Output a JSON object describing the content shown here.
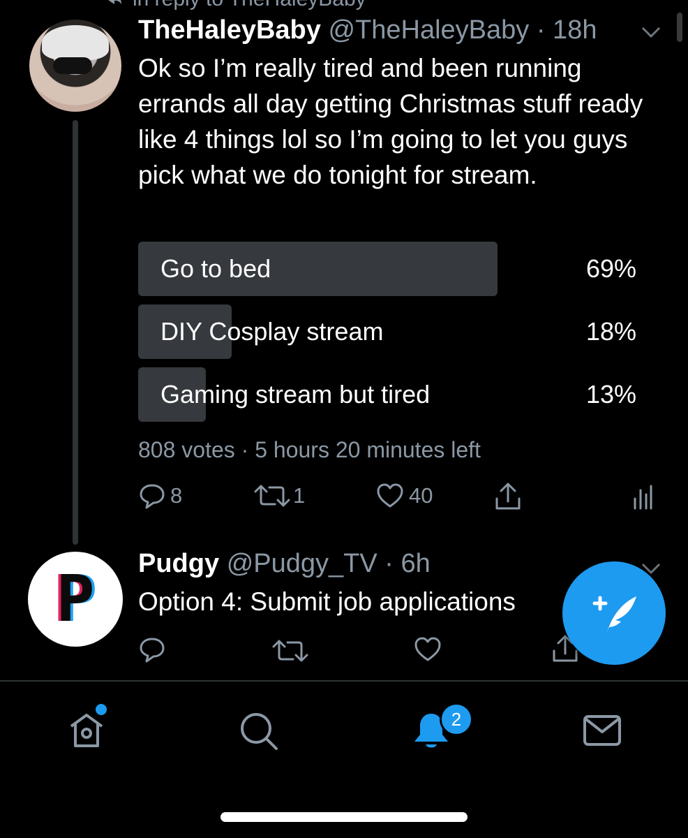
{
  "reply_context": "in reply to TheHaleyBaby",
  "tweet": {
    "name": "TheHaleyBaby",
    "handle": "@TheHaleyBaby",
    "time": "· 18h",
    "text": "Ok so I’m really tired and been running errands all day getting Christmas stuff ready like 4 things lol so I’m going to let you guys pick what we do tonight for stream.",
    "poll": {
      "options": [
        {
          "label": "Go to bed",
          "percent_text": "69%",
          "percent": 69
        },
        {
          "label": "DIY Cosplay stream",
          "percent_text": "18%",
          "percent": 18
        },
        {
          "label": "Gaming stream but tired",
          "percent_text": "13%",
          "percent": 13
        }
      ],
      "summary": "808 votes · 5 hours 20 minutes left"
    },
    "actions": {
      "replies": "8",
      "retweets": "1",
      "likes": "40"
    }
  },
  "reply": {
    "name": "Pudgy",
    "handle": "@Pudgy_TV",
    "time": "· 6h",
    "text": "Option 4: Submit job applications",
    "avatar_letter": "P"
  },
  "nav": {
    "notifications_badge": "2"
  },
  "colors": {
    "accent": "#1d9bf0",
    "muted": "#8b98a5",
    "poll_fill": "#36393d"
  }
}
